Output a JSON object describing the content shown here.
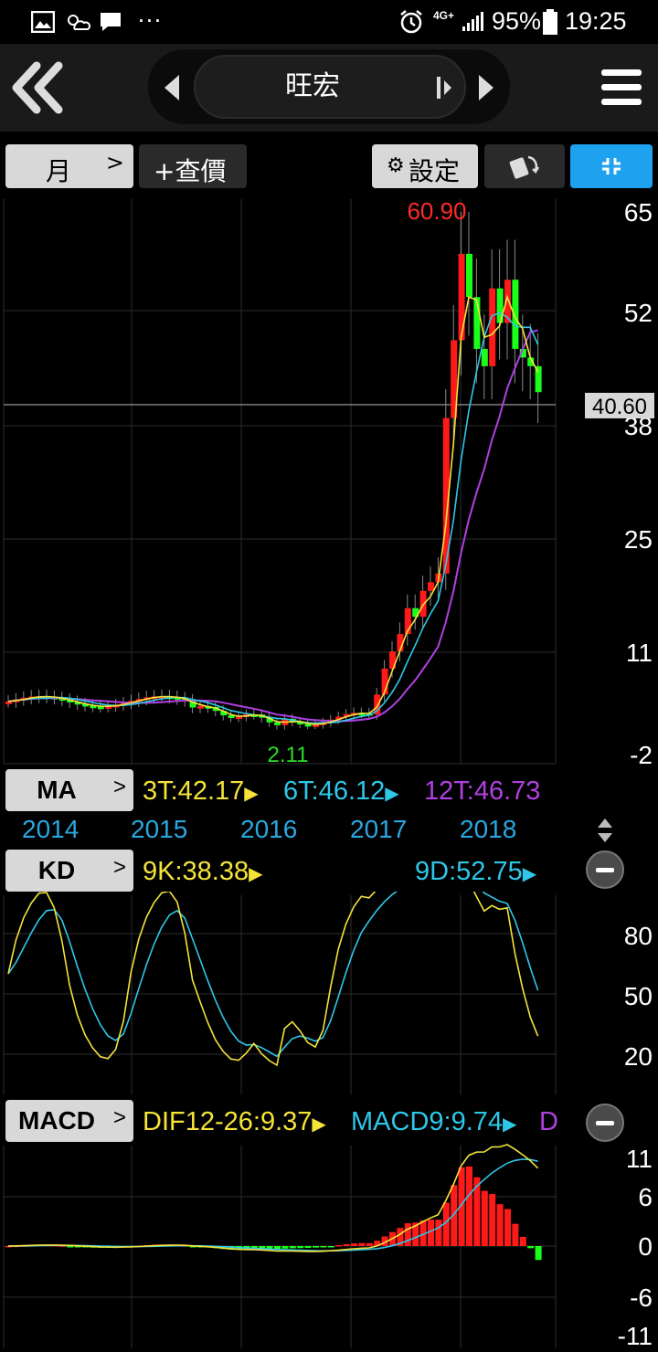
{
  "status_bar": {
    "battery": "95%",
    "time": "19:25",
    "network": "4G+",
    "more": "···"
  },
  "header": {
    "stock_name": "旺宏"
  },
  "toolbar": {
    "period": "月",
    "query_price": "+查價",
    "settings": "設定"
  },
  "price_chart": {
    "high_label": "60.90",
    "low_label": "2.11",
    "current_price_tag": "40.60",
    "y_ticks": [
      "65",
      "52",
      "38",
      "25",
      "11",
      "-2"
    ]
  },
  "ma": {
    "button_label": "MA",
    "values": [
      {
        "label": "3T:42.17",
        "color": "#f5e33a"
      },
      {
        "label": "6T:46.12",
        "color": "#2fc7e8"
      },
      {
        "label": "12T:46.73",
        "color": "#b040e0"
      }
    ]
  },
  "years": [
    "2014",
    "2015",
    "2016",
    "2017",
    "2018"
  ],
  "kd": {
    "button_label": "KD",
    "k_value": "9K:38.38",
    "d_value": "9D:52.75",
    "y_ticks": [
      "80",
      "50",
      "20"
    ]
  },
  "macd": {
    "button_label": "MACD",
    "dif_value": "DIF12-26:9.37",
    "macd_value": "MACD9:9.74",
    "osc_partial": "D",
    "y_ticks": [
      "11",
      "6",
      "0",
      "-6",
      "-11"
    ]
  },
  "colors": {
    "up": "#ff1a1a",
    "down": "#1aff1a",
    "ma3": "#f5e33a",
    "ma6": "#2fc7e8",
    "ma12": "#b040e0",
    "accent": "#1ea1ee"
  }
}
